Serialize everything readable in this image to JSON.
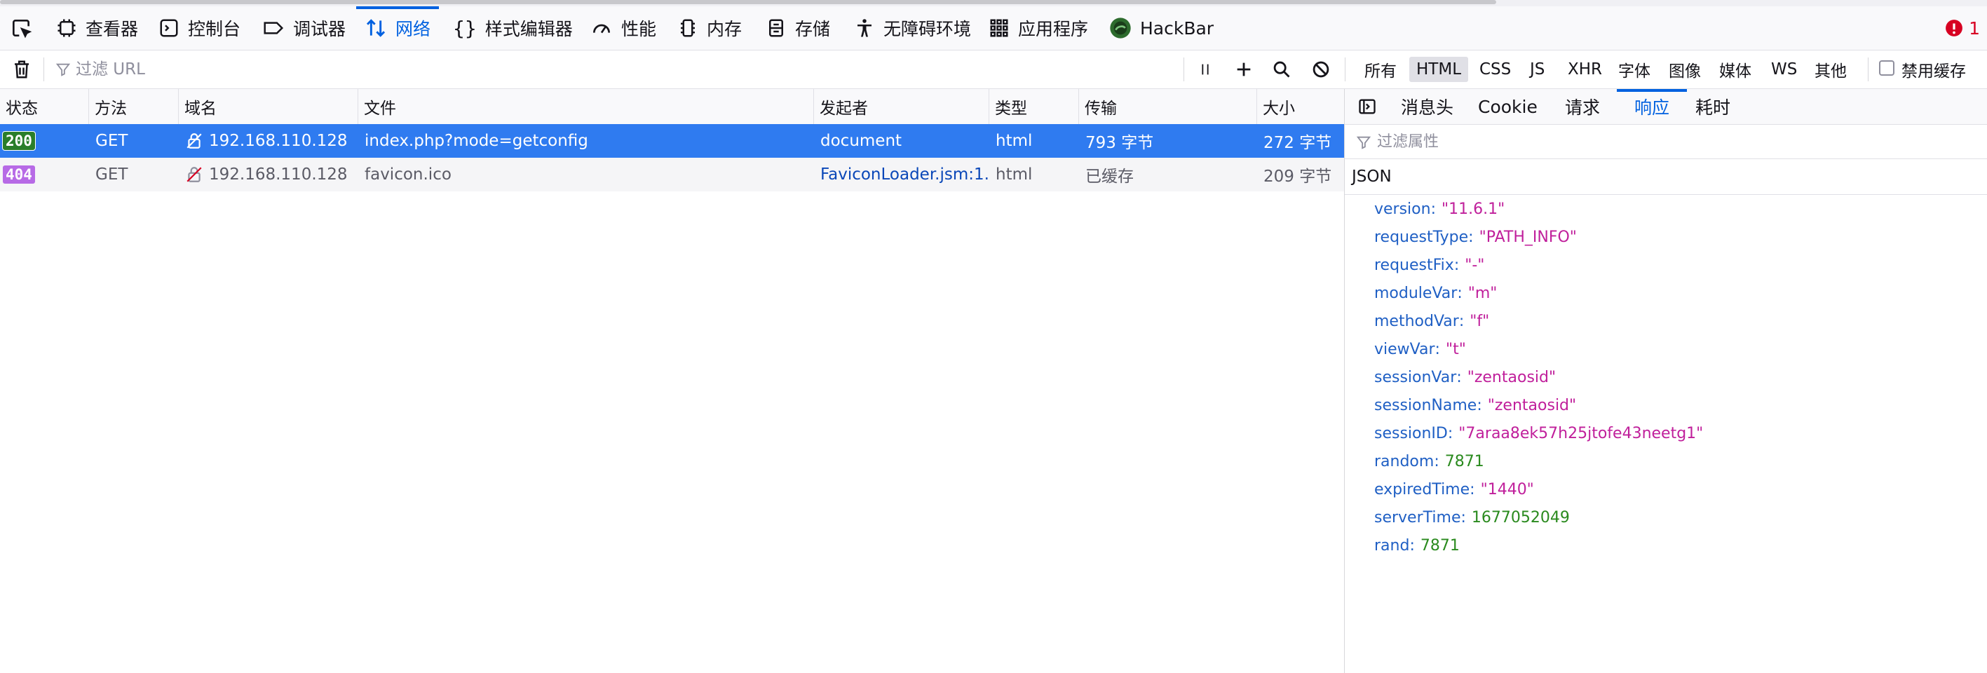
{
  "toolbar": {
    "tabs": [
      {
        "label": "查看器",
        "icon": "inspector-icon"
      },
      {
        "label": "控制台",
        "icon": "console-icon"
      },
      {
        "label": "调试器",
        "icon": "debugger-icon"
      },
      {
        "label": "网络",
        "icon": "network-icon",
        "selected": true
      },
      {
        "label": "样式编辑器",
        "icon": "style-editor-icon"
      },
      {
        "label": "性能",
        "icon": "performance-icon"
      },
      {
        "label": "内存",
        "icon": "memory-icon"
      },
      {
        "label": "存储",
        "icon": "storage-icon"
      },
      {
        "label": "无障碍环境",
        "icon": "accessibility-icon"
      },
      {
        "label": "应用程序",
        "icon": "application-icon"
      },
      {
        "label": "HackBar",
        "icon": "hackbar-icon"
      }
    ],
    "error_count": "1"
  },
  "filter": {
    "url_placeholder": "过滤 URL",
    "types": [
      "所有",
      "HTML",
      "CSS",
      "JS",
      "XHR",
      "字体",
      "图像",
      "媒体",
      "WS",
      "其他"
    ],
    "active_type": "HTML",
    "disable_cache_label": "禁用缓存"
  },
  "table": {
    "headers": [
      "状态",
      "方法",
      "域名",
      "文件",
      "发起者",
      "类型",
      "传输",
      "大小"
    ],
    "rows": [
      {
        "status": "200",
        "method": "GET",
        "domain": "192.168.110.128",
        "file": "index.php?mode=getconfig",
        "initiator": "document",
        "type": "html",
        "transferred": "793 字节",
        "size": "272 字节"
      },
      {
        "status": "404",
        "method": "GET",
        "domain": "192.168.110.128",
        "file": "favicon.ico",
        "initiator": "FaviconLoader.jsm:1...",
        "type": "html",
        "transferred": "已缓存",
        "size": "209 字节"
      }
    ]
  },
  "details": {
    "tabs": [
      "消息头",
      "Cookie",
      "请求",
      "响应",
      "耗时"
    ],
    "selected_tab": "响应",
    "filter_placeholder": "过滤属性",
    "section_title": "JSON",
    "json": [
      {
        "key": "version",
        "value": "\"11.6.1\"",
        "kind": "string"
      },
      {
        "key": "requestType",
        "value": "\"PATH_INFO\"",
        "kind": "string"
      },
      {
        "key": "requestFix",
        "value": "\"-\"",
        "kind": "string"
      },
      {
        "key": "moduleVar",
        "value": "\"m\"",
        "kind": "string"
      },
      {
        "key": "methodVar",
        "value": "\"f\"",
        "kind": "string"
      },
      {
        "key": "viewVar",
        "value": "\"t\"",
        "kind": "string"
      },
      {
        "key": "sessionVar",
        "value": "\"zentaosid\"",
        "kind": "string"
      },
      {
        "key": "sessionName",
        "value": "\"zentaosid\"",
        "kind": "string"
      },
      {
        "key": "sessionID",
        "value": "\"7araa8ek57h25jtofe43neetg1\"",
        "kind": "string"
      },
      {
        "key": "random",
        "value": "7871",
        "kind": "number"
      },
      {
        "key": "expiredTime",
        "value": "\"1440\"",
        "kind": "string"
      },
      {
        "key": "serverTime",
        "value": "1677052049",
        "kind": "number"
      },
      {
        "key": "rand",
        "value": "7871",
        "kind": "number"
      }
    ]
  },
  "colors": {
    "accent": "#0061e0",
    "selected_row": "#2f7bf0",
    "status_200": "#2a7e2a",
    "status_404": "#b76ae6",
    "json_key": "#1f5fc4",
    "json_string": "#c01f9b",
    "json_number": "#2a8a1e"
  }
}
